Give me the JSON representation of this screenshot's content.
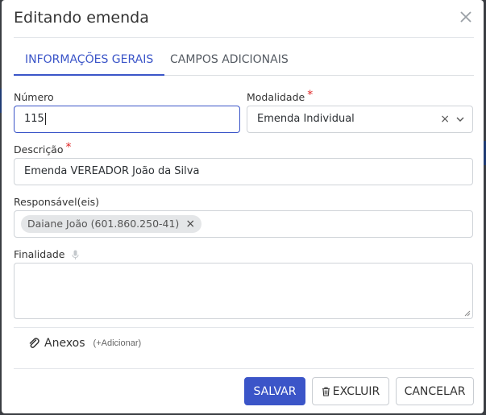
{
  "modal": {
    "title": "Editando emenda",
    "close_icon": "close-icon"
  },
  "tabs": [
    {
      "label": "INFORMAÇÕES GERAIS",
      "active": true
    },
    {
      "label": "CAMPOS ADICIONAIS",
      "active": false
    }
  ],
  "form": {
    "numero": {
      "label": "Número",
      "value": "115"
    },
    "modalidade": {
      "label": "Modalidade",
      "required_mark": "*",
      "value": "Emenda Individual",
      "clear_glyph": "×"
    },
    "descricao": {
      "label": "Descrição",
      "required_mark": "*",
      "value": "Emenda VEREADOR João da Silva"
    },
    "responsaveis": {
      "label": "Responsável(eis)",
      "chips": [
        {
          "label": "Daiane João (601.860.250-41)",
          "remove_glyph": "×"
        }
      ]
    },
    "finalidade": {
      "label": "Finalidade",
      "icon": "microphone-icon",
      "value": ""
    }
  },
  "attachments": {
    "label": "Anexos",
    "add_label": "(+Adicionar)",
    "icon": "paperclip-icon"
  },
  "footer": {
    "save_label": "SALVAR",
    "delete_label": "EXCLUIR",
    "cancel_label": "CANCELAR"
  },
  "colors": {
    "accent": "#3b55c8",
    "required": "#e02424"
  }
}
